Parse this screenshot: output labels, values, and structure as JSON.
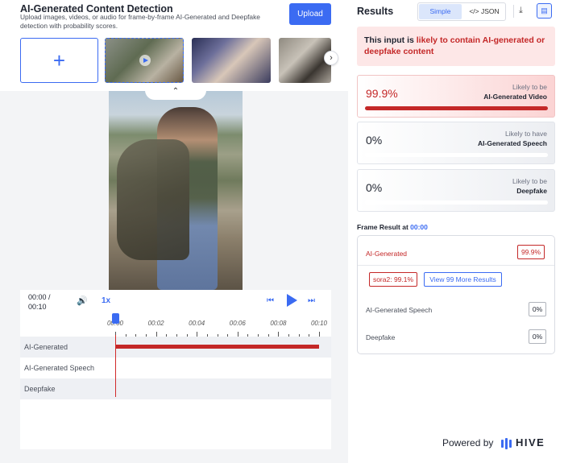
{
  "header": {
    "title": "AI-Generated Content Detection",
    "subtitle": "Upload images, videos, or audio for frame-by-frame AI-Generated and Deepfake detection with probability scores.",
    "upload_label": "Upload",
    "add_symbol": "+",
    "next_symbol": "›",
    "collapse_symbol": "⌃"
  },
  "player": {
    "time": "00:00 / 00:10",
    "speed": "1x",
    "volume_symbol": "🔊",
    "prev_symbol": "⏮",
    "next_symbol": "⏭",
    "ticks": [
      "00:00",
      "00:02",
      "00:04",
      "00:06",
      "00:08",
      "00:10"
    ],
    "tracks": [
      {
        "label": "AI-Generated"
      },
      {
        "label": "AI-Generated Speech"
      },
      {
        "label": "Deepfake"
      }
    ]
  },
  "results": {
    "title": "Results",
    "toggle_simple": "Simple",
    "toggle_json": "</> JSON",
    "download_symbol": "⤓",
    "layout_symbol": "▤",
    "alert_prefix": "This input is ",
    "alert_highlight": "likely to contain AI-generated or deepfake content",
    "cards": [
      {
        "pct": "99.9%",
        "value": 0.999,
        "line1": "Likely to be",
        "line2": "AI-Generated Video"
      },
      {
        "pct": "0%",
        "value": 0,
        "line1": "Likely to have",
        "line2": "AI-Generated Speech"
      },
      {
        "pct": "0%",
        "value": 0,
        "line1": "Likely to be",
        "line2": "Deepfake"
      }
    ],
    "frame_title": "Frame Result at ",
    "frame_time": "00:00",
    "frame_ai_label": "AI-Generated",
    "frame_ai_value": "99.9%",
    "sora_badge": "sora2: 99.1%",
    "more_results": "View 99 More Results",
    "frame_speech_label": "AI-Generated Speech",
    "frame_speech_value": "0%",
    "frame_deepfake_label": "Deepfake",
    "frame_deepfake_value": "0%",
    "powered_by": "Powered by",
    "brand": "HIVE"
  },
  "colors": {
    "accent": "#3b6bf2",
    "alert": "#c42828"
  }
}
